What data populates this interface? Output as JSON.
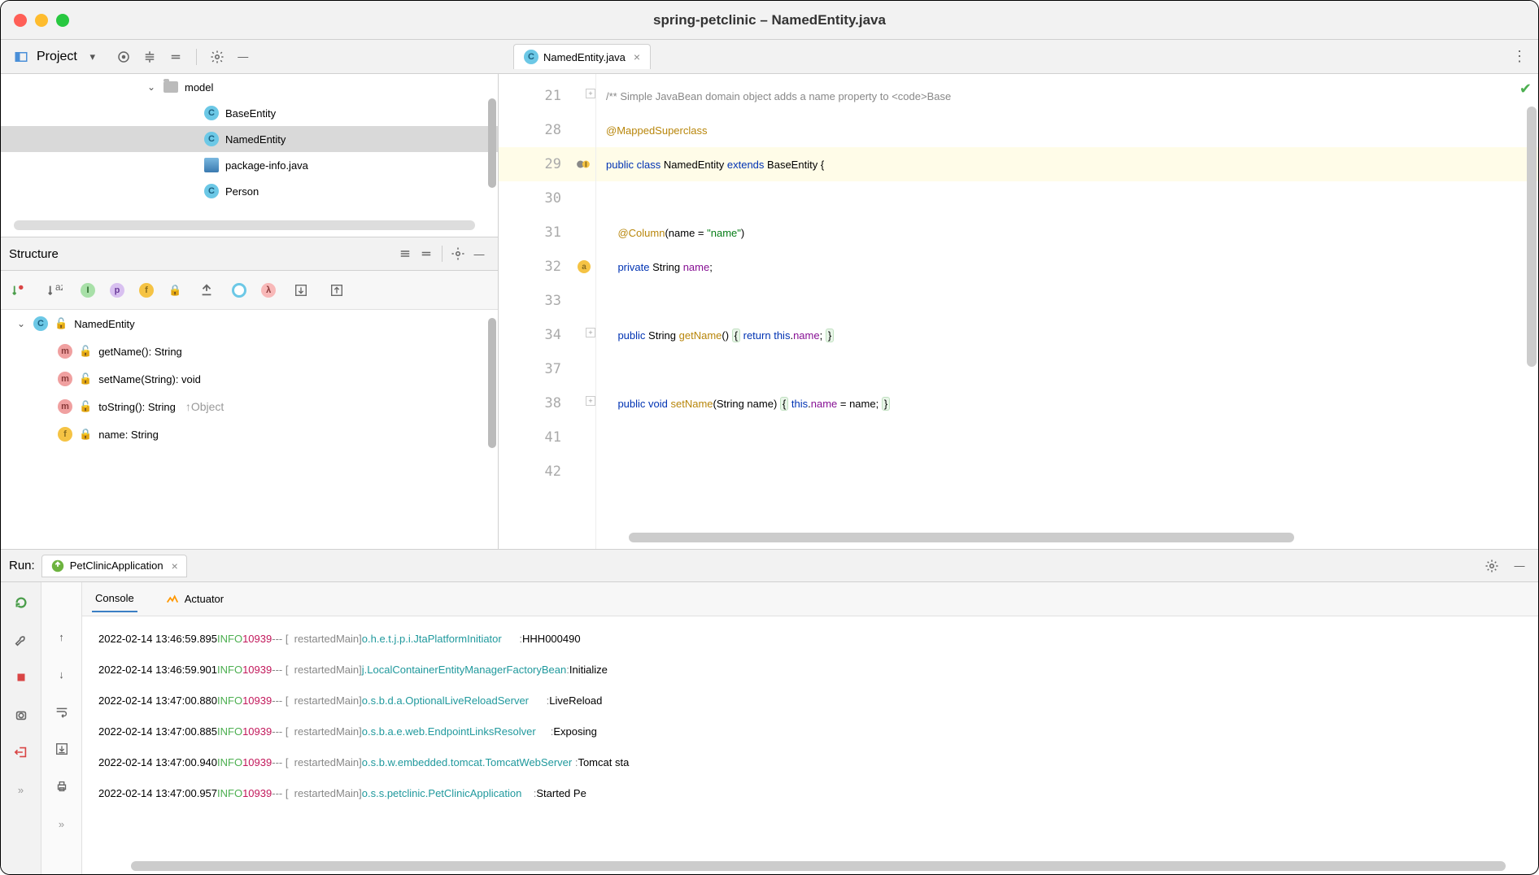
{
  "window": {
    "title": "spring-petclinic – NamedEntity.java"
  },
  "project": {
    "label": "Project",
    "folder": "model",
    "files": [
      {
        "icon": "c",
        "name": "BaseEntity",
        "sel": false
      },
      {
        "icon": "c",
        "name": "NamedEntity",
        "sel": true
      },
      {
        "icon": "java",
        "name": "package-info.java",
        "sel": false
      },
      {
        "icon": "c",
        "name": "Person",
        "sel": false
      }
    ]
  },
  "structure": {
    "label": "Structure",
    "root": "NamedEntity",
    "members": [
      {
        "icon": "m",
        "name": "getName(): String",
        "lock": true
      },
      {
        "icon": "m",
        "name": "setName(String): void",
        "lock": true
      },
      {
        "icon": "m",
        "name": "toString(): String",
        "lock": true,
        "up": "↑Object"
      },
      {
        "icon": "f",
        "name": "name: String",
        "lock": "orange"
      }
    ]
  },
  "tab": {
    "name": "NamedEntity.java"
  },
  "editor": {
    "lines": [
      {
        "n": 21,
        "fold": true,
        "html": [
          [
            "c-cm",
            "/** Simple JavaBean domain object adds a name property to <code>Base"
          ]
        ]
      },
      {
        "n": 28,
        "html": [
          [
            "c-an",
            "@MappedSuperclass"
          ]
        ]
      },
      {
        "n": 29,
        "hl": true,
        "gut": true,
        "html": [
          [
            "c-kw",
            "public class"
          ],
          [
            "",
            " "
          ],
          [
            "c-ty",
            "NamedEntity "
          ],
          [
            "c-kw",
            "extends"
          ],
          [
            "",
            " "
          ],
          [
            "c-ty",
            "BaseEntity"
          ],
          [
            "",
            " {"
          ]
        ]
      },
      {
        "n": 30,
        "html": []
      },
      {
        "n": 31,
        "html": [
          [
            "",
            "    "
          ],
          [
            "c-an",
            "@Column"
          ],
          [
            "",
            "(name = "
          ],
          [
            "c-st",
            "\"name\""
          ],
          [
            "",
            ")"
          ]
        ]
      },
      {
        "n": 32,
        "gut": "a",
        "html": [
          [
            "",
            "    "
          ],
          [
            "c-kw",
            "private"
          ],
          [
            "",
            " "
          ],
          [
            "c-ty",
            "String "
          ],
          [
            "c-id",
            "name"
          ],
          [
            "",
            ";"
          ]
        ]
      },
      {
        "n": 33,
        "html": []
      },
      {
        "n": 34,
        "fold": true,
        "html": [
          [
            "",
            "    "
          ],
          [
            "c-kw",
            "public"
          ],
          [
            "",
            " "
          ],
          [
            "c-ty",
            "String "
          ],
          [
            "c-an",
            "getName"
          ],
          [
            "",
            "() "
          ],
          [
            "c-fold",
            "{"
          ],
          [
            "",
            " "
          ],
          [
            "c-kw",
            "return"
          ],
          [
            "",
            " "
          ],
          [
            "c-kw",
            "this"
          ],
          [
            "",
            "."
          ],
          [
            "c-id",
            "name"
          ],
          [
            "",
            "; "
          ],
          [
            "c-fold",
            "}"
          ]
        ]
      },
      {
        "n": 37,
        "html": []
      },
      {
        "n": 38,
        "fold": true,
        "html": [
          [
            "",
            "    "
          ],
          [
            "c-kw",
            "public void "
          ],
          [
            "c-an",
            "setName"
          ],
          [
            "",
            "(String name) "
          ],
          [
            "c-fold",
            "{"
          ],
          [
            "",
            " "
          ],
          [
            "c-kw",
            "this"
          ],
          [
            "",
            "."
          ],
          [
            "c-id",
            "name"
          ],
          [
            "",
            " = name; "
          ],
          [
            "c-fold",
            "}"
          ]
        ]
      },
      {
        "n": 41,
        "html": []
      },
      {
        "n": 42,
        "html": []
      }
    ]
  },
  "run": {
    "label": "Run:",
    "app": "PetClinicApplication",
    "tabs": {
      "console": "Console",
      "actuator": "Actuator"
    },
    "logs": [
      {
        "ts": "2022-02-14 13:46:59.895",
        "lvl": "INFO",
        "pid": "10939",
        "thr": "restartedMain",
        "src": "o.h.e.t.j.p.i.JtaPlatformInitiator",
        "msg": "HHH000490"
      },
      {
        "ts": "2022-02-14 13:46:59.901",
        "lvl": "INFO",
        "pid": "10939",
        "thr": "restartedMain",
        "src": "j.LocalContainerEntityManagerFactoryBean",
        "msg": "Initialize"
      },
      {
        "ts": "2022-02-14 13:47:00.880",
        "lvl": "INFO",
        "pid": "10939",
        "thr": "restartedMain",
        "src": "o.s.b.d.a.OptionalLiveReloadServer",
        "msg": "LiveReload"
      },
      {
        "ts": "2022-02-14 13:47:00.885",
        "lvl": "INFO",
        "pid": "10939",
        "thr": "restartedMain",
        "src": "o.s.b.a.e.web.EndpointLinksResolver",
        "msg": "Exposing "
      },
      {
        "ts": "2022-02-14 13:47:00.940",
        "lvl": "INFO",
        "pid": "10939",
        "thr": "restartedMain",
        "src": "o.s.b.w.embedded.tomcat.TomcatWebServer",
        "msg": "Tomcat sta"
      },
      {
        "ts": "2022-02-14 13:47:00.957",
        "lvl": "INFO",
        "pid": "10939",
        "thr": "restartedMain",
        "src": "o.s.s.petclinic.PetClinicApplication",
        "msg": "Started Pe"
      }
    ]
  }
}
